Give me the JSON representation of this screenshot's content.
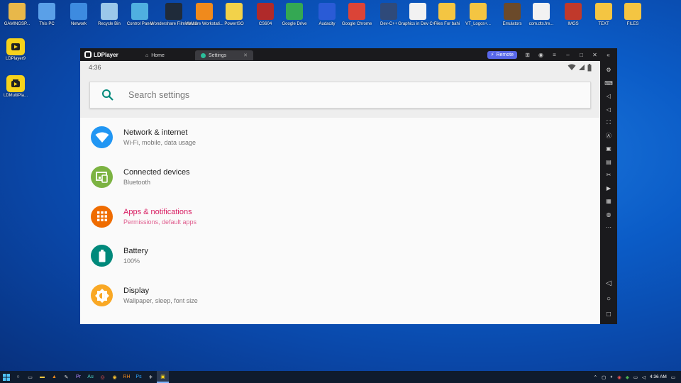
{
  "desktop": {
    "top_icons": [
      {
        "label": "GAMINGSP...",
        "icon": "user-folder-icon",
        "color": "#e8b84a"
      },
      {
        "label": "This PC",
        "icon": "monitor-icon",
        "color": "#5aa0e8"
      },
      {
        "label": "Network",
        "icon": "network-globe-icon",
        "color": "#3d8be0"
      },
      {
        "label": "Recycle Bin",
        "icon": "recycle-bin-icon",
        "color": "#9bc8ea"
      },
      {
        "label": "Control Panel",
        "icon": "control-panel-icon",
        "color": "#4fb0e0"
      },
      {
        "label": "Wondershare Filmora 12",
        "icon": "filmora-icon",
        "color": "#1f2b3a"
      },
      {
        "label": "VMware Workstati...",
        "icon": "vmware-icon",
        "color": "#f08a1c"
      },
      {
        "label": "PowerISO",
        "icon": "poweriso-disc-icon",
        "color": "#f2d24a"
      },
      {
        "label": "CS604",
        "icon": "book-icon",
        "color": "#b02a2a"
      },
      {
        "label": "Google Drive",
        "icon": "google-drive-icon",
        "color": "#34a853"
      },
      {
        "label": "Audacity",
        "icon": "audacity-icon",
        "color": "#2a5bd6"
      },
      {
        "label": "Google Chrome",
        "icon": "chrome-icon",
        "color": "#db4437"
      },
      {
        "label": "Dev-C++",
        "icon": "devcpp-icon",
        "color": "#2f4a7a"
      },
      {
        "label": "Graphics in Dev C++",
        "icon": "document-icon",
        "color": "#f2f2f2"
      },
      {
        "label": "Files For bahi",
        "icon": "folder-icon",
        "color": "#f4c542"
      },
      {
        "label": "VT_Logos+...",
        "icon": "folder-icon",
        "color": "#f4c542"
      },
      {
        "label": "Emulators",
        "icon": "folder-icon",
        "color": "#6b4a2a"
      },
      {
        "label": "com.dts.fre...",
        "icon": "file-icon",
        "color": "#f2f2f2"
      },
      {
        "label": "IMGS",
        "icon": "folder-icon",
        "color": "#c0392b"
      },
      {
        "label": "TEXT",
        "icon": "folder-icon",
        "color": "#f4c542"
      },
      {
        "label": "FILES",
        "icon": "folder-icon",
        "color": "#f4c542"
      }
    ],
    "left_icons": [
      {
        "label": "LDPlayer9",
        "icon": "ldplayer-icon"
      },
      {
        "label": "LDMultiPla...",
        "icon": "ldmultiplayer-icon"
      }
    ]
  },
  "window": {
    "app_name": "LDPlayer",
    "tabs": [
      {
        "label": "Home",
        "icon": "home-icon"
      },
      {
        "label": "Settings",
        "icon": "settings-app-icon",
        "close": "✕"
      }
    ],
    "remote_label": "Remote"
  },
  "android": {
    "time": "4:36",
    "search_placeholder": "Search settings",
    "items": [
      {
        "title": "Network & internet",
        "subtitle": "Wi-Fi, mobile, data usage",
        "icon": "wifi-icon",
        "color": "#2196f3"
      },
      {
        "title": "Connected devices",
        "subtitle": "Bluetooth",
        "icon": "connected-devices-icon",
        "color": "#7cb342"
      },
      {
        "title": "Apps & notifications",
        "subtitle": "Permissions, default apps",
        "icon": "apps-grid-icon",
        "color": "#ef6c00"
      },
      {
        "title": "Battery",
        "subtitle": "100%",
        "icon": "battery-icon",
        "color": "#00897b"
      },
      {
        "title": "Display",
        "subtitle": "Wallpaper, sleep, font size",
        "icon": "brightness-icon",
        "color": "#f9a825"
      }
    ]
  },
  "taskbar": {
    "time": "4:36 AM"
  }
}
